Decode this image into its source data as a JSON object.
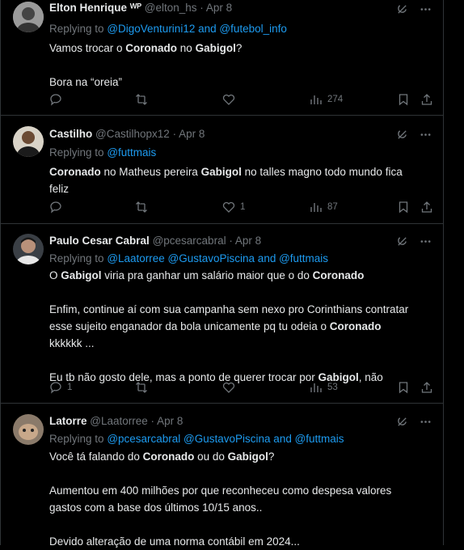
{
  "tweets": [
    {
      "name": "Elton Henrique",
      "badge": "ᵂᴾ",
      "handle": "@elton_hs",
      "date": "Apr 8",
      "replying_prefix": "Replying to",
      "replying_to": "@DigoVenturini12 and @futebol_info",
      "views": "274",
      "replies": "",
      "likes": ""
    },
    {
      "name": "Castilho",
      "handle": "@Castilhopx12",
      "date": "Apr 8",
      "replying_prefix": "Replying to",
      "replying_to": "@futtmais",
      "views": "87",
      "replies": "",
      "likes": "1"
    },
    {
      "name": "Paulo Cesar Cabral",
      "handle": "@pcesarcabral",
      "date": "Apr 8",
      "replying_prefix": "Replying to",
      "replying_to": "@Laatorree @GustavoPiscina and @futtmais",
      "views": "53",
      "replies": "1",
      "likes": ""
    },
    {
      "name": "Latorre",
      "handle": "@Laatorree",
      "date": "Apr 8",
      "replying_prefix": "Replying to",
      "replying_to": "@pcesarcabral @GustavoPiscina and @futtmais"
    }
  ],
  "t1_l1_a": "Vamos trocar o ",
  "t1_l1_b": "Coronado",
  "t1_l1_c": " no ",
  "t1_l1_d": "Gabigol",
  "t1_l1_e": "?",
  "t1_l2": "Bora na “oreia”",
  "t2_l1_a": "Coronado",
  "t2_l1_b": " no Matheus pereira ",
  "t2_l1_c": "Gabigol",
  "t2_l1_d": " no talles magno todo mundo fica",
  "t2_l2": "feliz",
  "t3_l1_a": "O ",
  "t3_l1_b": "Gabigol",
  "t3_l1_c": " viria pra ganhar um salário maior que o do ",
  "t3_l1_d": "Coronado",
  "t3_l2": "Enfim, continue aí com sua campanha sem nexo pro Corinthians contratar",
  "t3_l3_a": "esse sujeito enganador da bola unicamente pq tu odeia o ",
  "t3_l3_b": "Coronado",
  "t3_l4": "kkkkkk ...",
  "t3_l5_a": "Eu tb não gosto dele, mas a ponto de querer trocar por ",
  "t3_l5_b": "Gabigol",
  "t3_l5_c": ", não",
  "t4_l1_a": "Você tá falando do ",
  "t4_l1_b": "Coronado",
  "t4_l1_c": " ou do ",
  "t4_l1_d": "Gabigol",
  "t4_l1_e": "?",
  "t4_l2": "Aumentou em 400 milhões por que reconheceu como despesa valores",
  "t4_l3": "gastos com a base dos últimos 10/15 anos..",
  "t4_l4": "Devido alteração de uma norma contábil em 2024...",
  "colors": {
    "background": "#000000",
    "text": "#e7e9ea",
    "muted": "#71767b",
    "link": "#1d9bf0",
    "border": "#2f3336"
  },
  "icons": [
    "reply-icon",
    "retweet-icon",
    "like-icon",
    "views-icon",
    "bookmark-icon",
    "share-icon",
    "grok-icon",
    "more-icon"
  ]
}
